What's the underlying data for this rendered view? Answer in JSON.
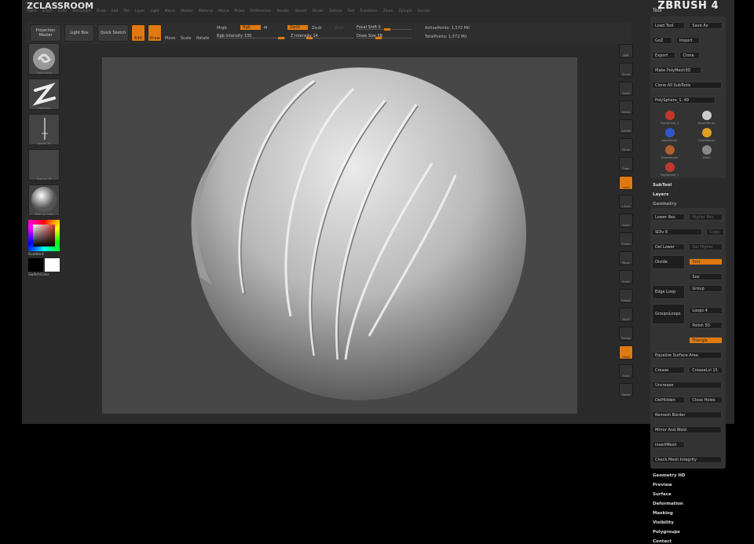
{
  "app": {
    "title": "ZCLASSROOM",
    "logo": "ZBRUSH 4"
  },
  "menu": [
    "Alpha",
    "Brush",
    "Color",
    "Document",
    "Draw",
    "Edit",
    "File",
    "Layer",
    "Light",
    "Macro",
    "Marker",
    "Material",
    "Movie",
    "Picker",
    "Preferences",
    "Render",
    "Stencil",
    "Stroke",
    "Texture",
    "Tool",
    "Transform",
    "Zoom",
    "Zplugin",
    "Zscript"
  ],
  "toolbar": {
    "projection_master": "Projection Master",
    "light_box": "Light Box",
    "quick_sketch": "Quick Sketch",
    "edit": "Edit",
    "draw": "Draw",
    "move": "Move",
    "scale": "Scale",
    "rotate": "Rotate",
    "mrgb": "Mrgb",
    "rgb": "Rgb",
    "m": "M",
    "zadd": "Zadd",
    "zsub": "Zsub",
    "zcut": "Zcut",
    "rgb_intensity": "Rgb Intensity 100",
    "z_intensity": "Z Intensity 14",
    "focal_shift": "Focal Shift 0",
    "draw_size": "Draw Size 58",
    "active_points": "ActivePoints: 1,572 Mil",
    "total_points": "TotalPoints: 1,572 Mil",
    "rgb_intensity_value": 100,
    "z_intensity_value": 14,
    "focal_shift_value": 0,
    "draw_size_value": 58
  },
  "left": {
    "brush": "ClayBuildup",
    "stroke": "FreeHand",
    "alpha": "Alpha Off",
    "texture": "Texture Off",
    "material": "MatCap Gray",
    "gradient": "Gradient",
    "switch_color": "SwitchColor"
  },
  "shelf": [
    "BPR",
    "Scroll",
    "Zoom",
    "Actual",
    "AAHalf",
    "Persp",
    "Floor",
    "Local",
    "L.Sym",
    "Gxyz",
    "Frame",
    "Move",
    "Scale",
    "Rotate",
    "PolyF",
    "Transp",
    "Ghost",
    "Solo",
    "Xpose"
  ],
  "tool": {
    "header": "Tool",
    "load_tool": "Load Tool",
    "save_as": "Save As",
    "goz": "GoZ",
    "import": "Import",
    "export": "Export",
    "clone": "Clone",
    "make_polymesh": "Make PolyMesh3D",
    "clone_all": "Clone All SubTools",
    "current": "PolySphere_1. 49",
    "items": [
      "PolySphere_1",
      "SphereBrush",
      "AlphaBrush",
      "SimpleBrush",
      "EraserBrush",
      "Wire3",
      "PolySphere_1"
    ],
    "subtool": "SubTool",
    "layers": "Layers",
    "geometry": "Geometry",
    "geo": {
      "lower_res": "Lower Res",
      "higher_res": "Higher Res",
      "sdiv": "SDiv 6",
      "cage": "Cage",
      "del_lower": "Del Lower",
      "del_higher": "Del Higher",
      "divide": "Divide",
      "smt": "Smt",
      "suv": "Suv",
      "edge_loop": "Edge Loop",
      "group": "Group",
      "grouploops": "GroupsLoops",
      "loops": "Loops 4",
      "polish": "Polish 50",
      "triangle": "Triangle",
      "equalize": "Equalize Surface Area",
      "crease": "Crease",
      "crease_lvl": "CreaseLvl 15",
      "uncrease": "Uncrease",
      "del_hidden": "DelHidden",
      "close_holes": "Close Holes",
      "remesh_border": "Remesh Border",
      "mirror_weld": "Mirror And Weld",
      "insert_mesh": "InsertMesh",
      "check_mesh": "Check Mesh Integrity"
    },
    "sections": [
      "Geometry HD",
      "Preview",
      "Surface",
      "Deformation",
      "Masking",
      "Visibility",
      "Polygroups",
      "Contact"
    ]
  }
}
